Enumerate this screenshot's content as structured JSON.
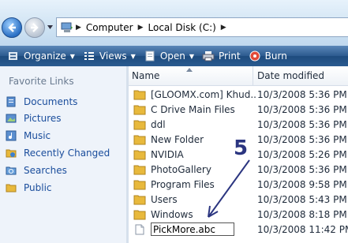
{
  "address": {
    "crumbs": [
      "Computer",
      "Local Disk (C:)"
    ]
  },
  "toolbar": {
    "organize": "Organize",
    "views": "Views",
    "open": "Open",
    "print": "Print",
    "burn": "Burn"
  },
  "sidebar": {
    "title": "Favorite Links",
    "items": [
      {
        "label": "Documents",
        "icon": "documents-icon"
      },
      {
        "label": "Pictures",
        "icon": "pictures-icon"
      },
      {
        "label": "Music",
        "icon": "music-icon"
      },
      {
        "label": "Recently Changed",
        "icon": "recently-changed-icon"
      },
      {
        "label": "Searches",
        "icon": "search-folder-icon"
      },
      {
        "label": "Public",
        "icon": "public-folder-icon"
      }
    ]
  },
  "columns": {
    "name": "Name",
    "date": "Date modified"
  },
  "files": [
    {
      "name": "[GLOOMX.com] Khud...",
      "date": "10/3/2008 5:36 PM",
      "type": "folder"
    },
    {
      "name": "C Drive Main Files",
      "date": "10/3/2008 5:36 PM",
      "type": "folder"
    },
    {
      "name": "ddl",
      "date": "10/3/2008 5:36 PM",
      "type": "folder"
    },
    {
      "name": "New Folder",
      "date": "10/3/2008 5:36 PM",
      "type": "folder"
    },
    {
      "name": "NVIDIA",
      "date": "10/3/2008 5:26 PM",
      "type": "folder"
    },
    {
      "name": "PhotoGallery",
      "date": "10/3/2008 5:36 PM",
      "type": "folder"
    },
    {
      "name": "Program Files",
      "date": "10/3/2008 9:58 PM",
      "type": "folder"
    },
    {
      "name": "Users",
      "date": "10/3/2008 5:43 PM",
      "type": "folder"
    },
    {
      "name": "Windows",
      "date": "10/3/2008 8:18 PM",
      "type": "folder"
    },
    {
      "name": "PickMore.abc",
      "date": "10/3/2008 11:42 PM",
      "type": "file",
      "renaming": true
    }
  ],
  "annotation": {
    "step": "5"
  },
  "colors": {
    "command_bar": "#2a5b90",
    "link": "#1a4d9c",
    "sidebar_bg": "#eef3fa",
    "folder": "#e8b93c"
  }
}
